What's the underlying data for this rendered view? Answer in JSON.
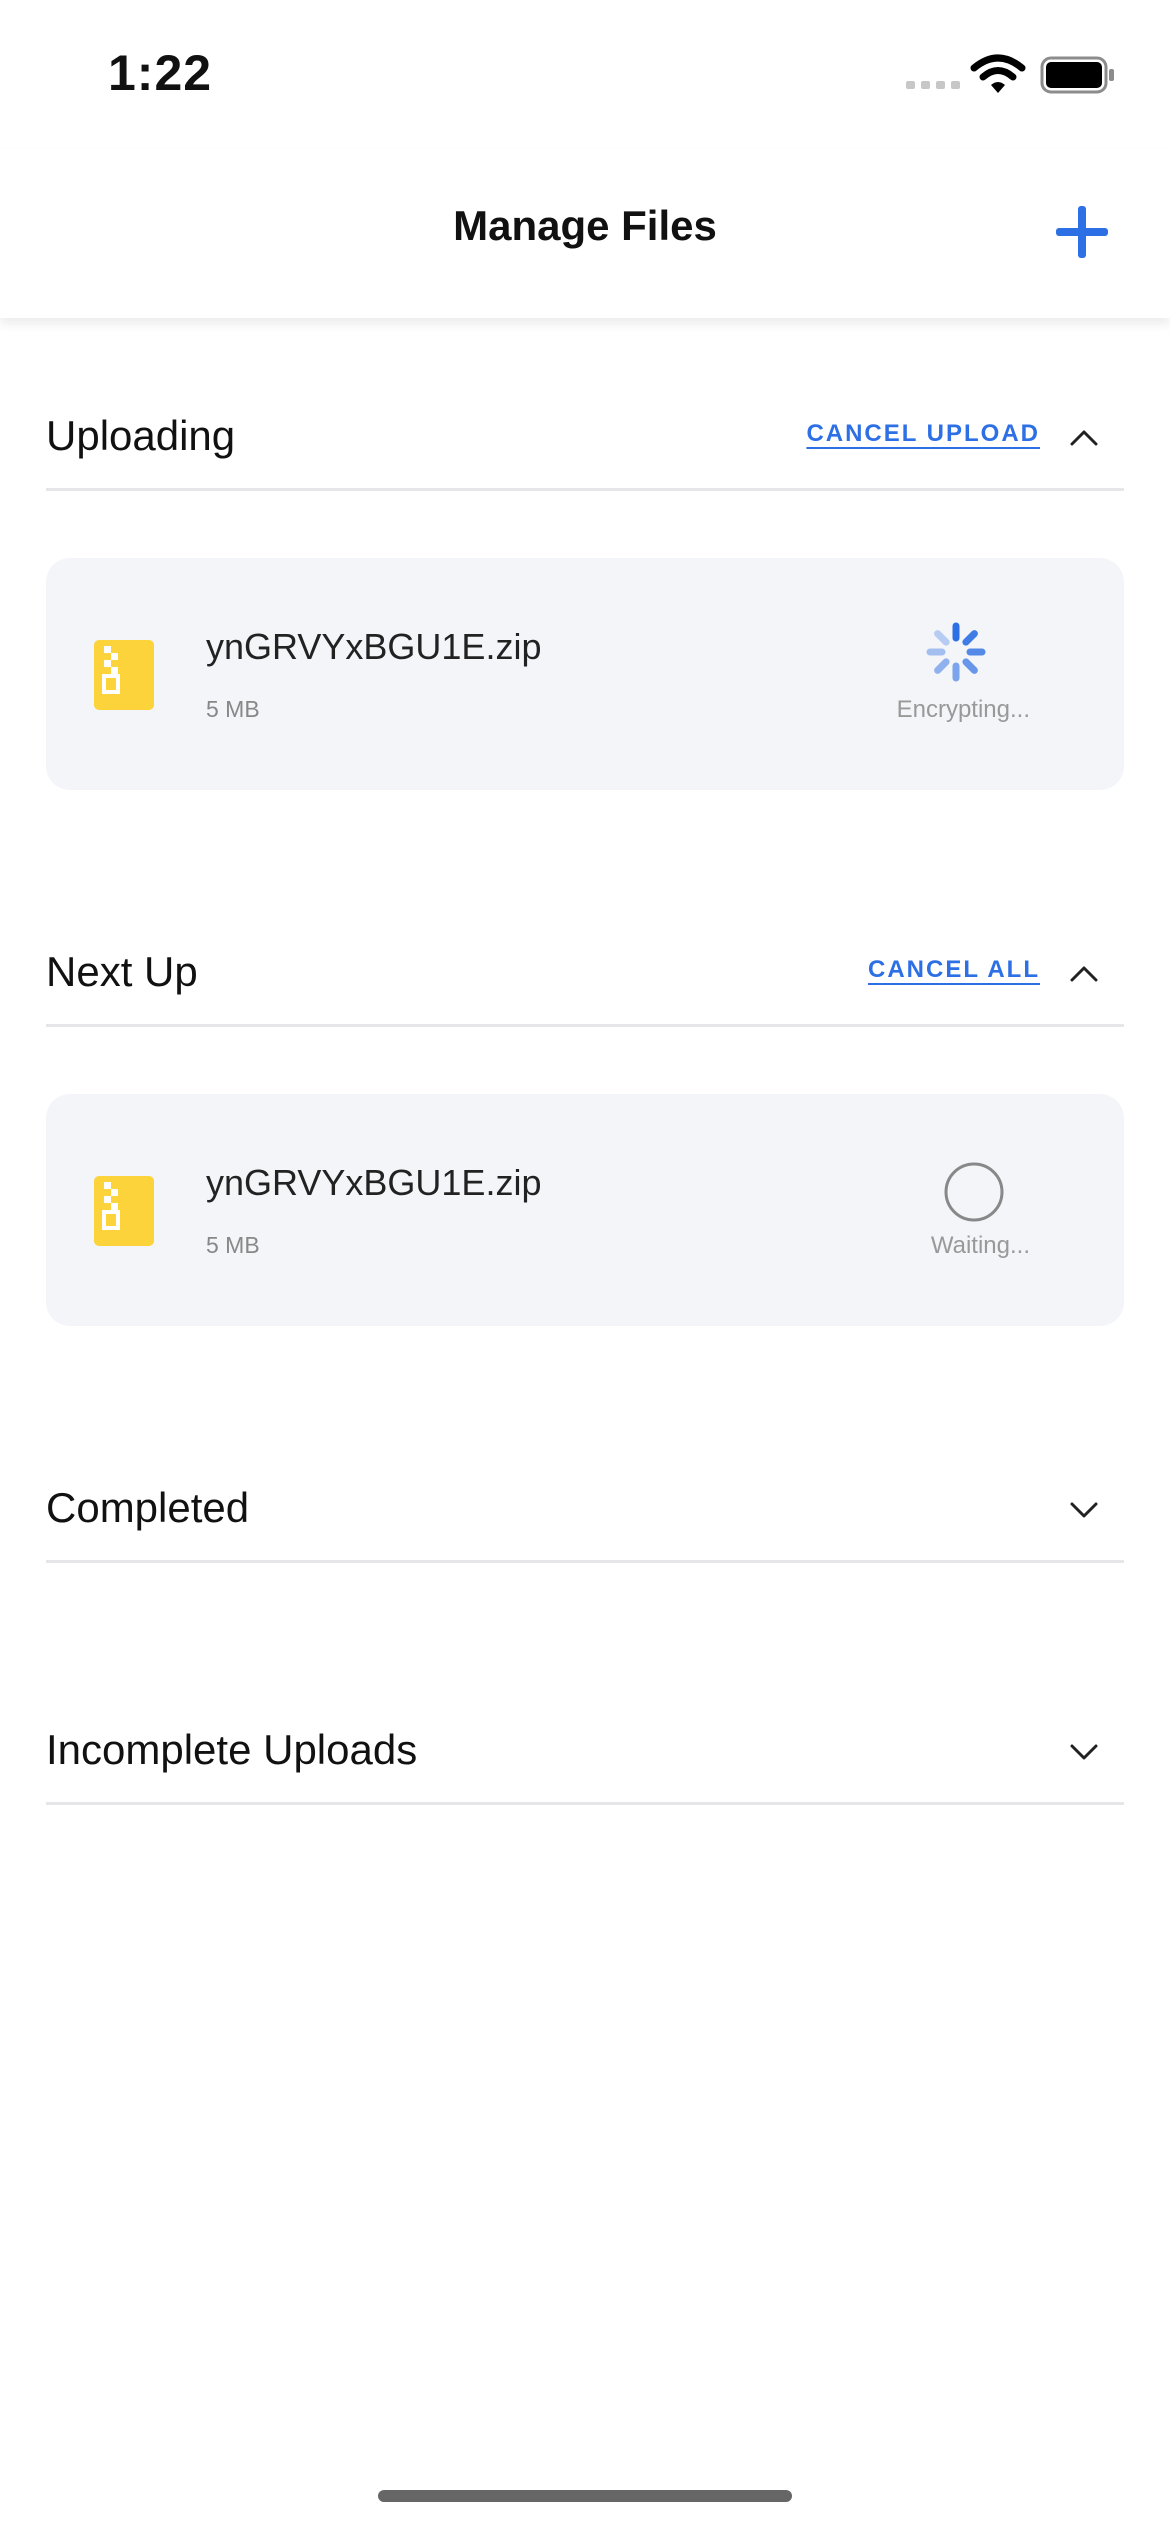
{
  "status_bar": {
    "time": "1:22"
  },
  "nav": {
    "title": "Manage Files",
    "add_icon": "plus-icon"
  },
  "colors": {
    "accent": "#2d6fe5",
    "zip_yellow": "#fcd33a",
    "card_bg": "#f4f5f9"
  },
  "sections": {
    "uploading": {
      "title": "Uploading",
      "action": "CANCEL UPLOAD",
      "expanded": true,
      "file": {
        "name": "ynGRVYxBGU1E.zip",
        "size": "5 MB",
        "status": "Encrypting..."
      }
    },
    "next_up": {
      "title": "Next Up",
      "action": "CANCEL ALL",
      "expanded": true,
      "file": {
        "name": "ynGRVYxBGU1E.zip",
        "size": "5 MB",
        "status": "Waiting..."
      }
    },
    "completed": {
      "title": "Completed",
      "expanded": false
    },
    "incomplete": {
      "title": "Incomplete Uploads",
      "expanded": false
    }
  }
}
